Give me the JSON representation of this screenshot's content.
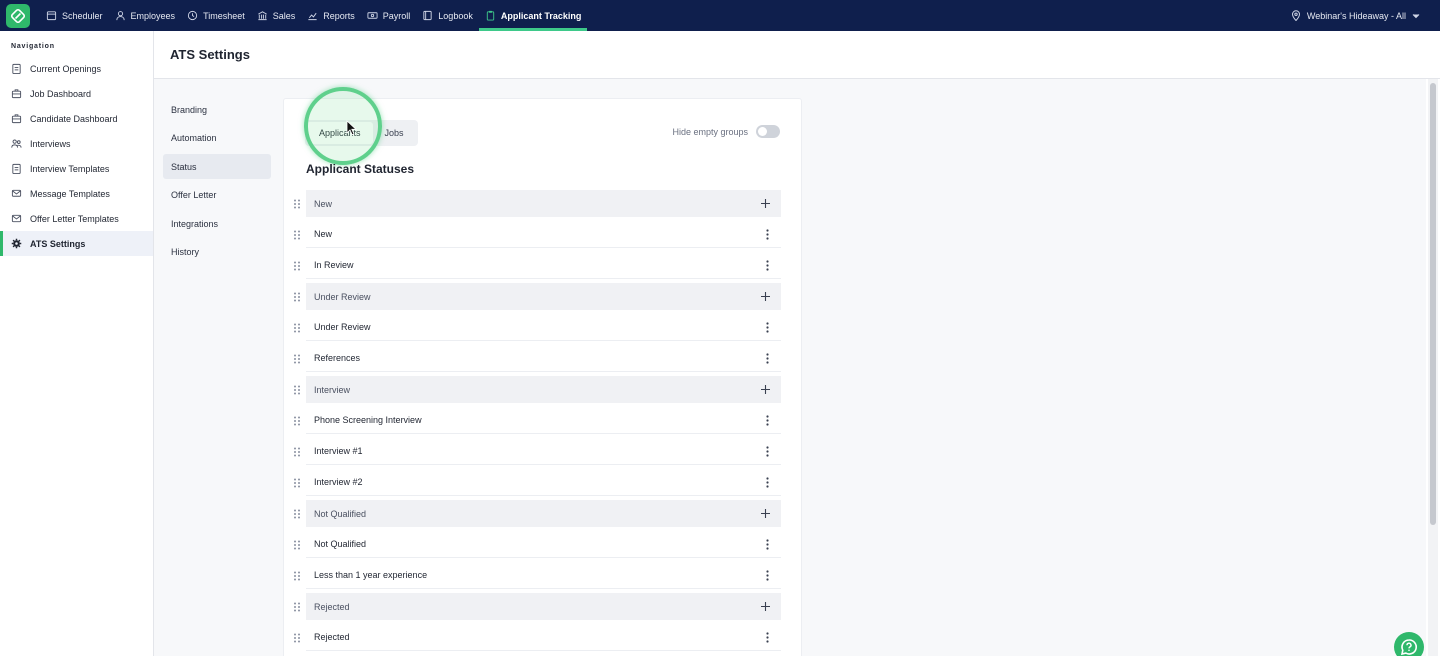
{
  "topnav": {
    "items": [
      {
        "label": "Scheduler",
        "icon": "calendar-icon"
      },
      {
        "label": "Employees",
        "icon": "person-icon"
      },
      {
        "label": "Timesheet",
        "icon": "clock-icon"
      },
      {
        "label": "Sales",
        "icon": "bank-icon"
      },
      {
        "label": "Reports",
        "icon": "chart-icon"
      },
      {
        "label": "Payroll",
        "icon": "money-icon"
      },
      {
        "label": "Logbook",
        "icon": "book-icon"
      },
      {
        "label": "Applicant Tracking",
        "icon": "clipboard-icon",
        "active": true
      }
    ],
    "location": "Webinar's Hideaway - All",
    "accent": "#3ec98a",
    "bg": "#0f1f4d"
  },
  "leftnav": {
    "title": "Navigation",
    "items": [
      {
        "label": "Current Openings",
        "icon": "clipboard-icon"
      },
      {
        "label": "Job Dashboard",
        "icon": "briefcase-icon"
      },
      {
        "label": "Candidate Dashboard",
        "icon": "briefcase-icon"
      },
      {
        "label": "Interviews",
        "icon": "people-icon"
      },
      {
        "label": "Interview Templates",
        "icon": "clipboard-icon"
      },
      {
        "label": "Message Templates",
        "icon": "message-icon"
      },
      {
        "label": "Offer Letter Templates",
        "icon": "envelope-icon"
      },
      {
        "label": "ATS Settings",
        "icon": "gear-icon",
        "active": true
      }
    ]
  },
  "page": {
    "title": "ATS Settings"
  },
  "subnav": {
    "items": [
      "Branding",
      "Automation",
      "Status",
      "Offer Letter",
      "Integrations",
      "History"
    ],
    "active": "Status"
  },
  "card": {
    "tabs": [
      "Applicants",
      "Jobs"
    ],
    "active_tab": "Applicants",
    "hide_empty_label": "Hide empty groups",
    "hide_empty_on": false,
    "section_title": "Applicant Statuses",
    "rows": [
      {
        "type": "group",
        "label": "New"
      },
      {
        "type": "status",
        "label": "New"
      },
      {
        "type": "status",
        "label": "In Review"
      },
      {
        "type": "group",
        "label": "Under Review"
      },
      {
        "type": "status",
        "label": "Under Review"
      },
      {
        "type": "status",
        "label": "References"
      },
      {
        "type": "group",
        "label": "Interview"
      },
      {
        "type": "status",
        "label": "Phone Screening Interview"
      },
      {
        "type": "status",
        "label": "Interview #1"
      },
      {
        "type": "status",
        "label": "Interview #2"
      },
      {
        "type": "group",
        "label": "Not Qualified"
      },
      {
        "type": "status",
        "label": "Not Qualified"
      },
      {
        "type": "status",
        "label": "Less than 1 year experience"
      },
      {
        "type": "group",
        "label": "Rejected"
      },
      {
        "type": "status",
        "label": "Rejected"
      }
    ]
  }
}
